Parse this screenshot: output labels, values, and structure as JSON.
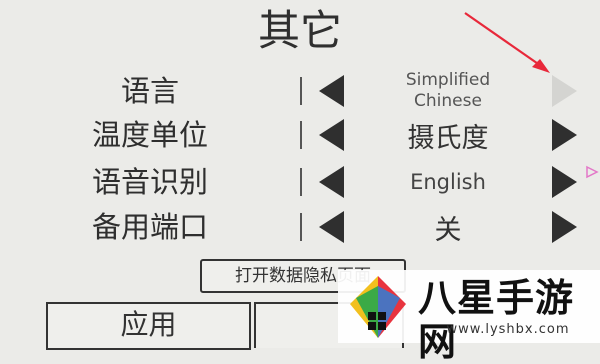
{
  "screen": {
    "title": "其它"
  },
  "settings": [
    {
      "label": "语言",
      "value": "Simplified Chinese",
      "right_arrow_enabled": false
    },
    {
      "label": "温度单位",
      "value": "摄氏度",
      "right_arrow_enabled": true
    },
    {
      "label": "语音识别",
      "value": "English",
      "right_arrow_enabled": true
    },
    {
      "label": "备用端口",
      "value": "关",
      "right_arrow_enabled": true
    }
  ],
  "buttons": {
    "privacy_page": "打开数据隐私页面",
    "apply": "应用"
  },
  "icons": {
    "left": "triangle-left-icon",
    "right": "triangle-right-icon",
    "annotation": "red-arrow-icon"
  },
  "colors": {
    "background": "#ebebe8",
    "arrow_enabled": "#2f2f2f",
    "arrow_disabled": "#d4d4d1",
    "annotation": "#e8283a"
  },
  "watermark": {
    "title": "八星手游网",
    "url": "www.lyshbx.com"
  }
}
